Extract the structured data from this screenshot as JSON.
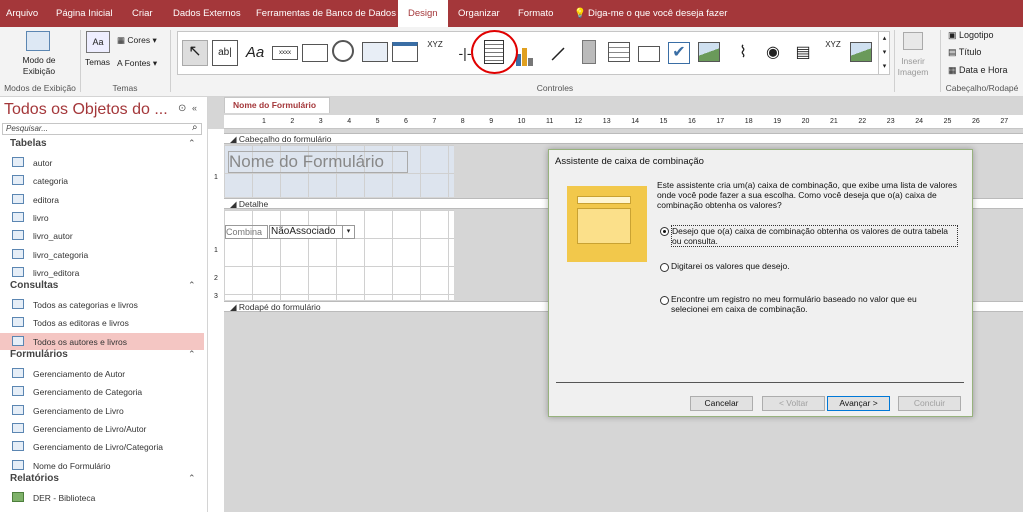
{
  "tabs": [
    "Arquivo",
    "Página Inicial",
    "Criar",
    "Dados Externos",
    "Ferramentas de Banco de Dados",
    "Design",
    "Organizar",
    "Formato"
  ],
  "tell_me": "Diga-me o que você deseja fazer",
  "ribbon": {
    "view_label_1": "Modo de",
    "view_label_2": "Exibição",
    "group_view": "Modos de Exibição",
    "themes_label": "Temas",
    "colors_label": "Cores",
    "fonts_label": "Fontes",
    "group_themes": "Temas",
    "group_controls": "Controles",
    "insert_image_1": "Inserir",
    "insert_image_2": "Imagem",
    "logo_label": "Logotipo",
    "title_label": "Título",
    "datetime_label": "Data e Hora",
    "group_header": "Cabeçalho/Rodapé"
  },
  "nav": {
    "title": "Todos os Objetos do ...",
    "search_placeholder": "Pesquisar...",
    "sections": [
      {
        "label": "Tabelas",
        "items": [
          "autor",
          "categoria",
          "editora",
          "livro",
          "livro_autor",
          "livro_categoria",
          "livro_editora"
        ]
      },
      {
        "label": "Consultas",
        "items": [
          "Todos as categorias e livros",
          "Todos as editoras e livros",
          "Todos os autores e livros"
        ]
      },
      {
        "label": "Formulários",
        "items": [
          "Gerenciamento de Autor",
          "Gerenciamento de Categoria",
          "Gerenciamento de Livro",
          "Gerenciamento de Livro/Autor",
          "Gerenciamento de Livro/Categoria",
          "Nome do Formulário"
        ]
      },
      {
        "label": "Relatórios",
        "items": [
          "DER - Biblioteca"
        ]
      }
    ]
  },
  "design": {
    "doc_tab": "Nome do Formulário",
    "header_band": "Cabeçalho do formulário",
    "detail_band": "Detalhe",
    "footer_band": "Rodapé do formulário",
    "form_title": "Nome do Formulário",
    "combo_label": "Combina",
    "combo_value": "NãoAssociado",
    "ruler": [
      "1",
      "2",
      "3",
      "4",
      "5",
      "6",
      "7",
      "8",
      "9",
      "10",
      "11",
      "12",
      "13",
      "14",
      "15",
      "16",
      "17",
      "18",
      "19",
      "20",
      "21",
      "22",
      "23",
      "24",
      "25",
      "26",
      "27"
    ]
  },
  "dialog": {
    "title": "Assistente de caixa de combinação",
    "intro": "Este assistente cria um(a) caixa de combinação, que exibe uma lista de valores onde você pode fazer a sua escolha.  Como você deseja que o(a) caixa de combinação obtenha os valores?",
    "option1": "Desejo que o(a) caixa de combinação obtenha os valores de outra tabela ou consulta.",
    "option2": "Digitarei os valores que desejo.",
    "option3": "Encontre um registro no meu formulário baseado no valor que eu selecionei em caixa de combinação.",
    "btn_cancel": "Cancelar",
    "btn_back": "< Voltar",
    "btn_next": "Avançar >",
    "btn_finish": "Concluir"
  },
  "colors": {
    "accent": "#a4373a",
    "annotation": "#e00000",
    "selected_item": "#f4c6c3"
  }
}
